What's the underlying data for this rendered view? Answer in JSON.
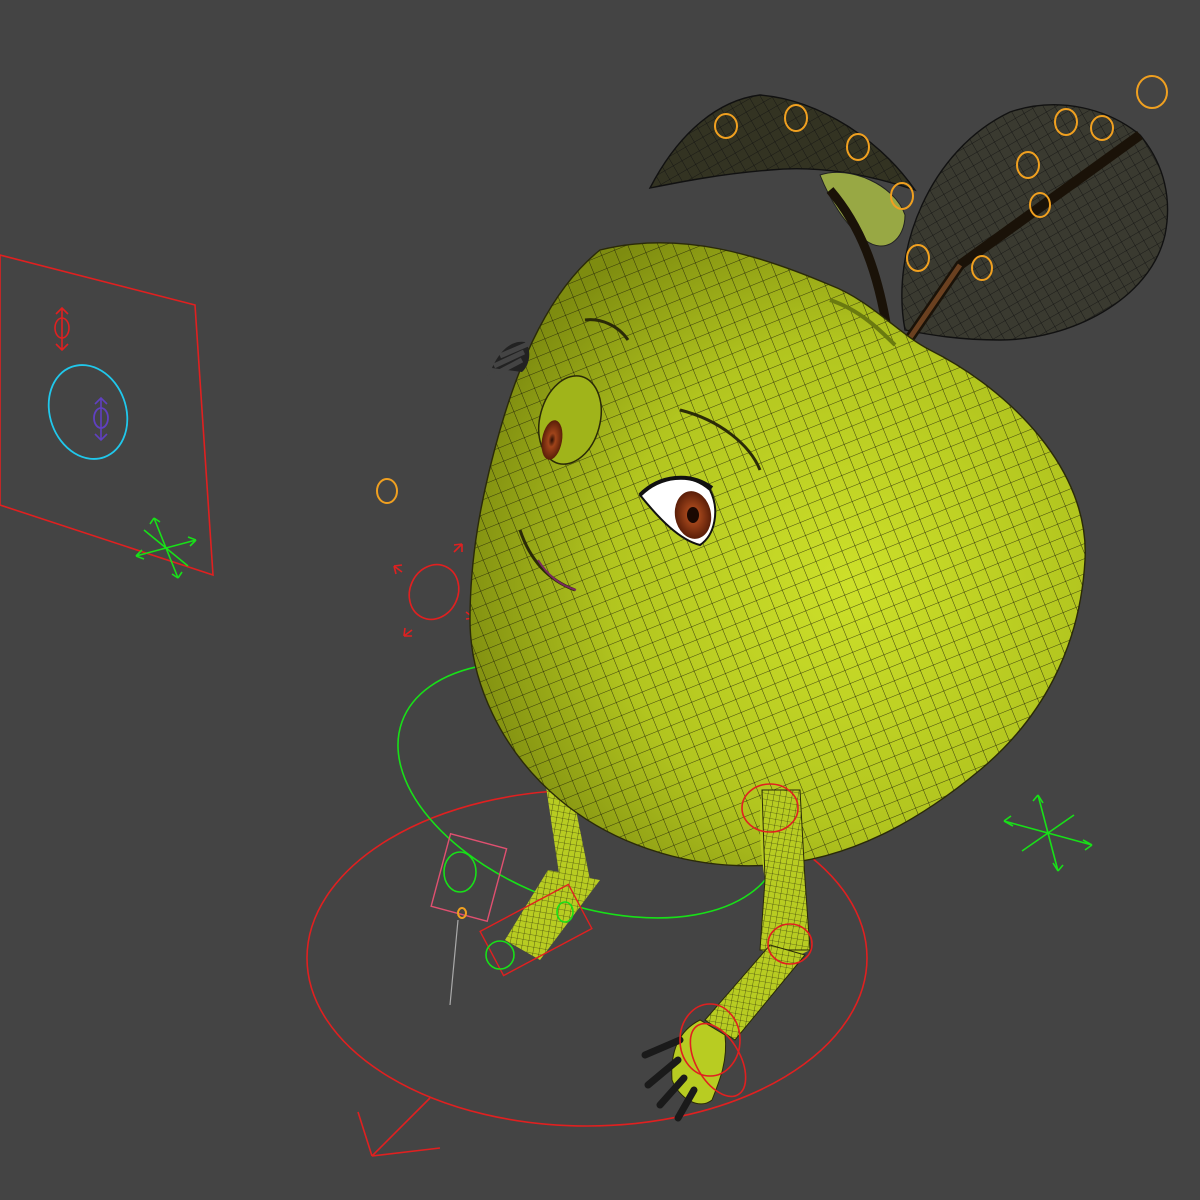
{
  "viewport": {
    "background": "#444444",
    "render_mode": "smooth-shaded-with-wireframe"
  },
  "character": {
    "body_color": "#b8cc22",
    "wire_color": "#1a1a08",
    "eye_iris_color": "#a0441a"
  },
  "rig_colors": {
    "main": "#e02020",
    "secondary": "#18e018",
    "facial": "#20c8ec",
    "leaf_bones": "#f0a020"
  },
  "icons": [
    "move-gizmo-icon",
    "rotate-gizmo-icon",
    "direction-arrow-icon"
  ]
}
